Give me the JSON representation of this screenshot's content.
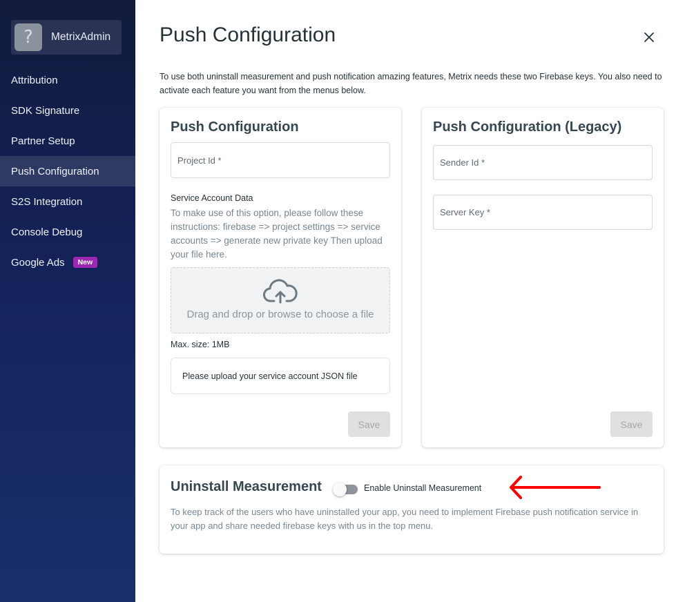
{
  "sidebar": {
    "brand": {
      "name": "MetrixAdmin",
      "logo_icon": "question-mark-placeholder"
    },
    "items": [
      {
        "label": "Attribution",
        "active": false
      },
      {
        "label": "SDK Signature",
        "active": false
      },
      {
        "label": "Partner Setup",
        "active": false
      },
      {
        "label": "Push Configuration",
        "active": true
      },
      {
        "label": "S2S Integration",
        "active": false
      },
      {
        "label": "Console Debug",
        "active": false
      },
      {
        "label": "Google Ads",
        "active": false,
        "badge": "New"
      }
    ]
  },
  "header": {
    "title": "Push Configuration",
    "close_icon": "close-icon",
    "intro": "To use both uninstall measurement and push notification amazing features, Metrix needs these two Firebase keys. You also need to activate each feature you want from the menus below."
  },
  "push_card": {
    "title": "Push Configuration",
    "project_id": {
      "placeholder": "Project Id *",
      "value": ""
    },
    "service_account": {
      "label": "Service Account Data",
      "description": "To make use of this option, please follow these instructions: firebase => project settings => service accounts => generate new private key Then upload your file here."
    },
    "dropzone": {
      "icon": "cloud-upload-icon",
      "text": "Drag and drop or browse to choose a file"
    },
    "max_size": "Max. size: 1MB",
    "upload_status": "Please upload your service account JSON file",
    "save_label": "Save"
  },
  "legacy_card": {
    "title": "Push Configuration (Legacy)",
    "sender_id": {
      "placeholder": "Sender Id *",
      "value": ""
    },
    "server_key": {
      "placeholder": "Server Key *",
      "value": ""
    },
    "save_label": "Save"
  },
  "uninstall_card": {
    "title": "Uninstall Measurement",
    "toggle": {
      "label": "Enable Uninstall Measurement",
      "enabled": false
    },
    "description": "To keep track of the users who have uninstalled your app, you need to implement Firebase push notification service in your app and share needed firebase keys with us in the top menu."
  },
  "annotation": {
    "type": "arrow",
    "color": "#ff0000",
    "points_to": "Enable Uninstall Measurement"
  },
  "colors": {
    "sidebar_top": "#121b3d",
    "sidebar_bottom": "#19306b",
    "badge": "#9c27b0",
    "disabled_button": "#e0e0e0"
  }
}
